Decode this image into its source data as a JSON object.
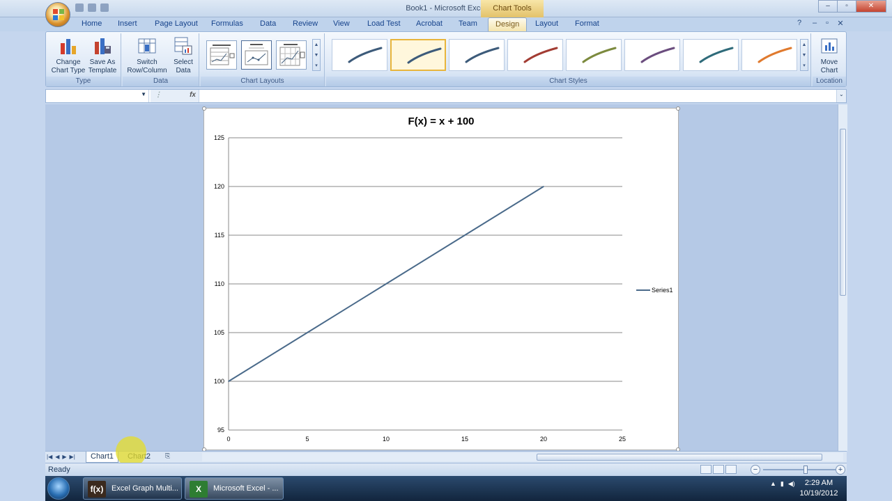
{
  "window": {
    "title": "Book1 - Microsoft Excel",
    "context_tab": "Chart Tools",
    "controls": [
      "–",
      "▫",
      "✕"
    ]
  },
  "ribbon_tabs": [
    "Home",
    "Insert",
    "Page Layout",
    "Formulas",
    "Data",
    "Review",
    "View",
    "Load Test",
    "Acrobat",
    "Team",
    "Design",
    "Layout",
    "Format"
  ],
  "active_tab": "Design",
  "ribbon": {
    "type_group": {
      "label": "Type",
      "change_chart_type": [
        "Change",
        "Chart Type"
      ],
      "save_as_template": [
        "Save As",
        "Template"
      ]
    },
    "data_group": {
      "label": "Data",
      "switch_row_column": [
        "Switch",
        "Row/Column"
      ],
      "select_data": [
        "Select",
        "Data"
      ]
    },
    "chart_layouts_label": "Chart Layouts",
    "chart_styles_label": "Chart Styles",
    "style_colors": [
      "#3d5b7a",
      "#3d5b7a",
      "#3d5b7a",
      "#a23c33",
      "#7c8a3e",
      "#6b4d7e",
      "#2f6b7a",
      "#e07a2e"
    ],
    "location_group": {
      "label": "Location",
      "move_chart": [
        "Move",
        "Chart"
      ]
    }
  },
  "formula_bar": {
    "name_box": "",
    "fx_label": "fx",
    "content": ""
  },
  "chart_data": {
    "type": "line",
    "title": "F(x) = x + 100",
    "xlabel": "",
    "ylabel": "",
    "x": [
      0,
      5,
      10,
      15,
      20
    ],
    "series": [
      {
        "name": "Series1",
        "values": [
          100,
          105,
          110,
          115,
          120
        ],
        "color": "#4a6a8a"
      }
    ],
    "xlim": [
      0,
      25
    ],
    "ylim": [
      95,
      125
    ],
    "x_ticks": [
      "0",
      "5",
      "10",
      "15",
      "20",
      "25"
    ],
    "y_ticks": [
      "95",
      "100",
      "105",
      "110",
      "115",
      "120",
      "125"
    ],
    "grid": true,
    "legend": "right"
  },
  "sheet_tabs": [
    "Chart1",
    "Chart2"
  ],
  "active_sheet": "Chart1",
  "status": {
    "text": "Ready"
  },
  "taskbar": {
    "items": [
      {
        "label": "Excel Graph Multi...",
        "icon": "f(x)"
      },
      {
        "label": "Microsoft Excel - ...",
        "icon": "X"
      }
    ],
    "time": "2:29 AM",
    "date": "10/19/2012"
  }
}
